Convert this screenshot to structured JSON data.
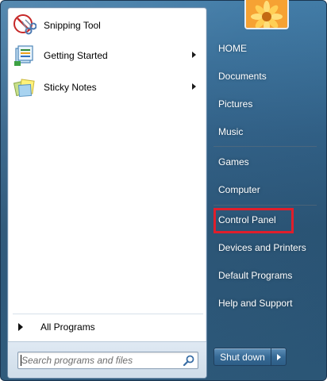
{
  "programs": [
    {
      "label": "Snipping Tool",
      "icon": "scissors-icon",
      "has_submenu": false
    },
    {
      "label": "Getting Started",
      "icon": "getting-started-icon",
      "has_submenu": true
    },
    {
      "label": "Sticky Notes",
      "icon": "sticky-notes-icon",
      "has_submenu": true
    }
  ],
  "all_programs": {
    "label": "All Programs"
  },
  "search": {
    "placeholder": "Search programs and files",
    "value": ""
  },
  "right_items": [
    {
      "label": "HOME"
    },
    {
      "label": "Documents"
    },
    {
      "label": "Pictures"
    },
    {
      "label": "Music"
    },
    {
      "label": "Games"
    },
    {
      "label": "Computer"
    },
    {
      "label": "Control Panel",
      "highlighted": true
    },
    {
      "label": "Devices and Printers"
    },
    {
      "label": "Default Programs"
    },
    {
      "label": "Help and Support"
    }
  ],
  "shutdown": {
    "label": "Shut down"
  },
  "colors": {
    "highlight": "#e01e2b",
    "accent": "#2f5f86"
  }
}
